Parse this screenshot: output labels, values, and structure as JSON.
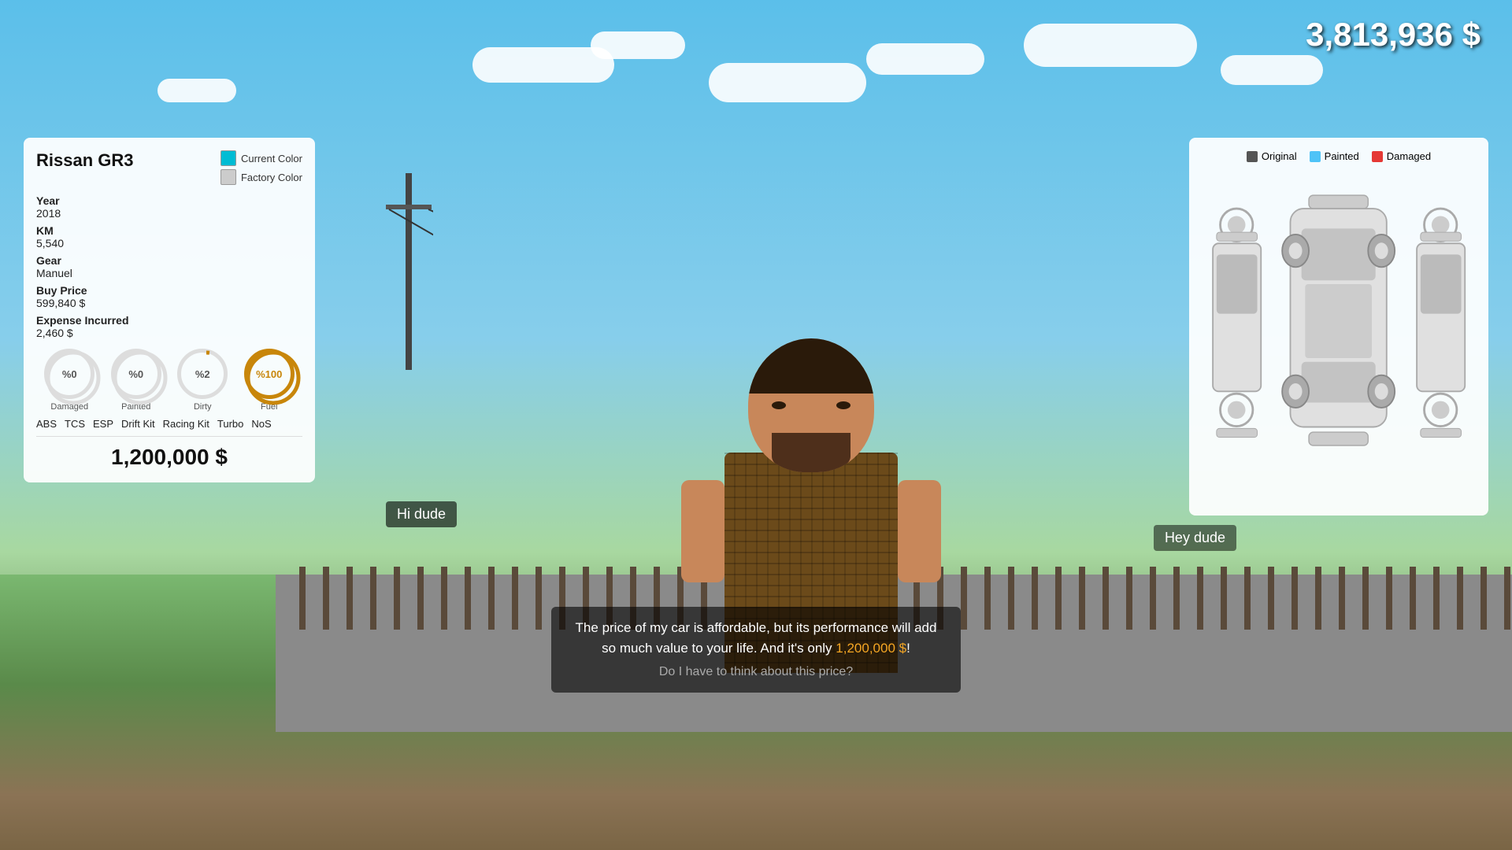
{
  "hud": {
    "money": "3,813,936 $"
  },
  "carPanel": {
    "title": "Rissan GR3",
    "currentColorLabel": "Current Color",
    "factoryColorLabel": "Factory Color",
    "currentColor": "#00bcd4",
    "factoryColor": "#cccccc",
    "yearLabel": "Year",
    "yearValue": "2018",
    "kmLabel": "KM",
    "kmValue": "5,540",
    "gearLabel": "Gear",
    "gearValue": "Manuel",
    "buyPriceLabel": "Buy Price",
    "buyPriceValue": "599,840 $",
    "expenseLabel": "Expense Incurred",
    "expenseValue": "2,460 $",
    "gauges": [
      {
        "label": "Damaged",
        "value": "%0",
        "percent": 0,
        "color": "#aaa"
      },
      {
        "label": "Painted",
        "value": "%0",
        "percent": 0,
        "color": "#aaa"
      },
      {
        "label": "Dirty",
        "value": "%2",
        "percent": 2,
        "color": "#c8860a"
      },
      {
        "label": "Fuel",
        "value": "%100",
        "percent": 100,
        "color": "#c8860a"
      }
    ],
    "extras": [
      "ABS",
      "TCS",
      "ESP",
      "Drift Kit",
      "Racing Kit",
      "Turbo",
      "NoS"
    ],
    "salePrice": "1,200,000 $"
  },
  "diagramPanel": {
    "legendOriginal": "Original",
    "legendPainted": "Painted",
    "legendDamaged": "Damaged",
    "originalColor": "#555",
    "paintedColor": "#4fc3f7",
    "damagedColor": "#e53935"
  },
  "dialog": {
    "greeting": "Hi dude",
    "response": "Hey dude",
    "pitch": "The price of my car is affordable, but its performance will add so much value to your life. And it's only 1,200,000 $!",
    "pitchHighlight": "1,200,000 $",
    "question": "Do I have to think about this price?"
  }
}
